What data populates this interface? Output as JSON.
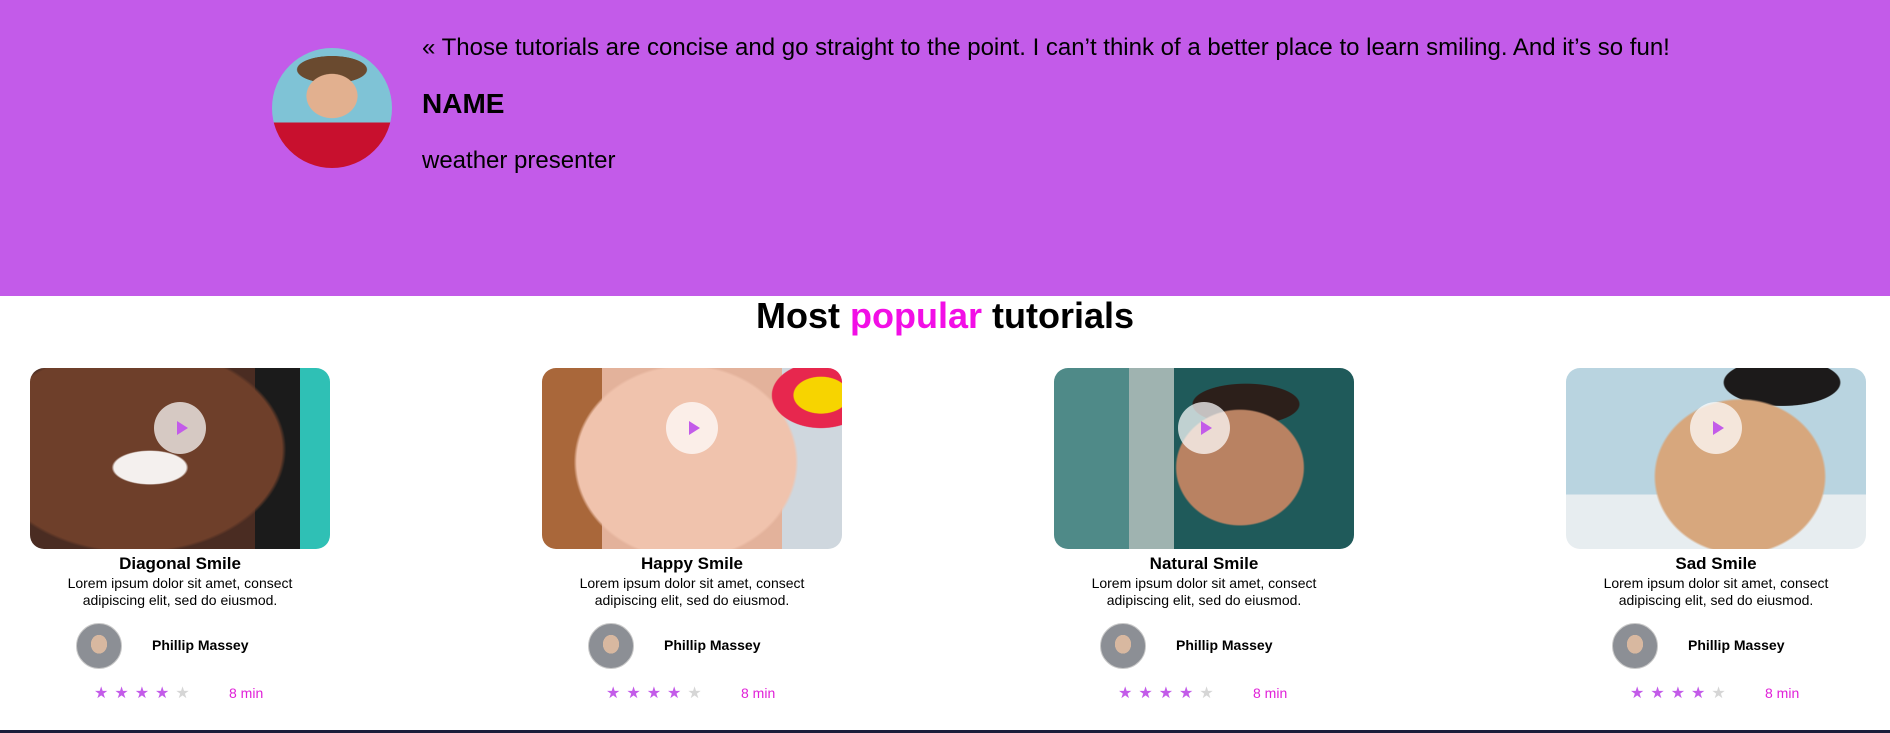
{
  "testimonial": {
    "quote": "« Those tutorials are concise and go straight to the point. I can’t think of a better place to learn smiling. And it’s so fun!",
    "name": "NAME",
    "role": "weather presenter"
  },
  "section": {
    "title_prefix": "Most",
    "title_accent": "popular",
    "title_suffix": "tutorials"
  },
  "colors": {
    "hero_bg": "#c35be9",
    "accent": "#f20ee6",
    "star": "#c35be9"
  },
  "cards": [
    {
      "title": "Diagonal Smile",
      "description": "Lorem ipsum dolor sit amet, consect adipiscing elit, sed do eiusmod.",
      "author": "Phillip Massey",
      "rating": 4,
      "rating_max": 5,
      "duration": "8 min"
    },
    {
      "title": "Happy Smile",
      "description": "Lorem ipsum dolor sit amet, consect adipiscing elit, sed do eiusmod.",
      "author": "Phillip Massey",
      "rating": 4,
      "rating_max": 5,
      "duration": "8 min"
    },
    {
      "title": "Natural Smile",
      "description": "Lorem ipsum dolor sit amet, consect adipiscing elit, sed do eiusmod.",
      "author": "Phillip Massey",
      "rating": 4,
      "rating_max": 5,
      "duration": "8 min"
    },
    {
      "title": "Sad Smile",
      "description": "Lorem ipsum dolor sit amet, consect adipiscing elit, sed do eiusmod.",
      "author": "Phillip Massey",
      "rating": 4,
      "rating_max": 5,
      "duration": "8 min"
    }
  ]
}
